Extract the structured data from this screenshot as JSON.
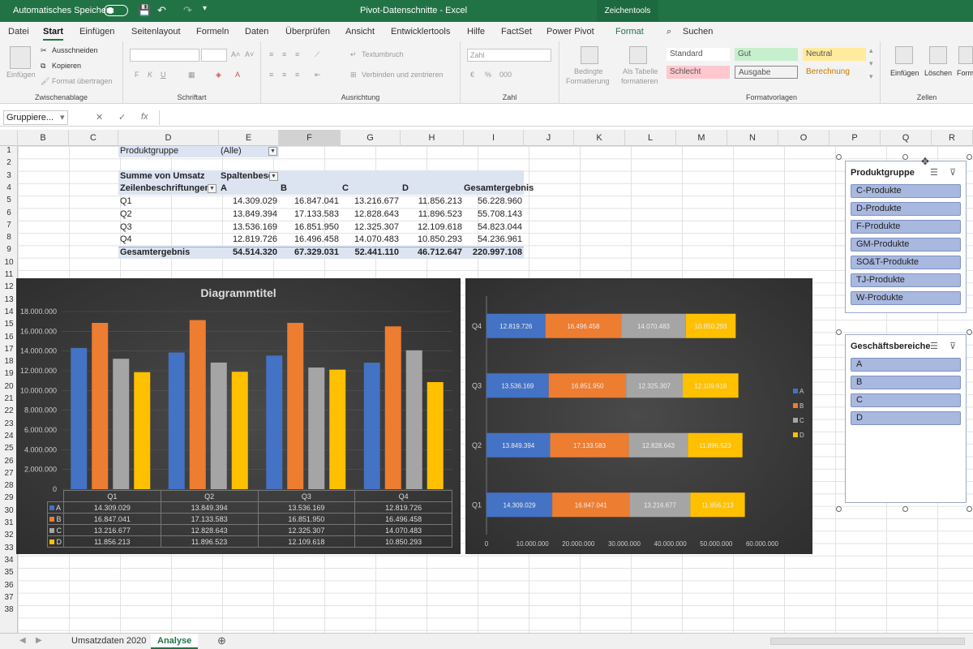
{
  "titlebar": {
    "autosave": "Automatisches Speichern",
    "title": "Pivot-Datenschnitte - Excel",
    "context_tab": "Zeichentools"
  },
  "menu": [
    "Datei",
    "Start",
    "Einfügen",
    "Seitenlayout",
    "Formeln",
    "Daten",
    "Überprüfen",
    "Ansicht",
    "Entwicklertools",
    "Hilfe",
    "FactSet",
    "Power Pivot",
    "Format"
  ],
  "search": "Suchen",
  "ribbon": {
    "clipboard": {
      "label": "Zwischenablage",
      "paste": "Einfügen",
      "cut": "Ausschneiden",
      "copy": "Kopieren",
      "format_painter": "Format übertragen"
    },
    "font": {
      "label": "Schriftart",
      "bold": "F",
      "italic": "K",
      "underline": "U"
    },
    "alignment": {
      "label": "Ausrichtung",
      "wrap": "Textumbruch",
      "merge": "Verbinden und zentrieren"
    },
    "number": {
      "label": "Zahl",
      "format": "Zahl"
    },
    "cond": {
      "line1": "Bedingte",
      "line2": "Formatierung"
    },
    "astable": {
      "line1": "Als Tabelle",
      "line2": "formatieren"
    },
    "styles": {
      "label": "Formatvorlagen",
      "s1": "Standard",
      "s2": "Gut",
      "s3": "Neutral",
      "s4": "Schlecht",
      "s5": "Ausgabe",
      "s6": "Berechnung"
    },
    "cells": {
      "label": "Zellen",
      "insert": "Einfügen",
      "delete": "Löschen",
      "format": "Form"
    }
  },
  "formula": {
    "namebox": "Gruppiere...",
    "x": "✕",
    "check": "✓",
    "fx": "fx"
  },
  "columns": [
    "B",
    "C",
    "D",
    "E",
    "F",
    "G",
    "H",
    "I",
    "J",
    "K",
    "L",
    "M",
    "N",
    "O",
    "P",
    "Q",
    "R"
  ],
  "rows": [
    "1",
    "2",
    "3",
    "4",
    "5",
    "6",
    "7",
    "8",
    "9",
    "10",
    "11",
    "12",
    "13",
    "14",
    "15",
    "16",
    "17",
    "18",
    "19",
    "20",
    "21",
    "22",
    "23",
    "24",
    "25",
    "26",
    "27",
    "28",
    "29",
    "30",
    "31",
    "32",
    "33",
    "34",
    "35",
    "36",
    "37",
    "38"
  ],
  "pivot": {
    "filter_label": "Produktgruppe",
    "filter_value": "(Alle)",
    "sum_label": "Summe von Umsatz",
    "col_label": "Spaltenbesc",
    "row_label": "Zeilenbeschriftungen",
    "headers": [
      "A",
      "B",
      "C",
      "D",
      "Gesamtergebnis"
    ],
    "rows": [
      {
        "label": "Q1",
        "values": [
          "14.309.029",
          "16.847.041",
          "13.216.677",
          "11.856.213",
          "56.228.960"
        ]
      },
      {
        "label": "Q2",
        "values": [
          "13.849.394",
          "17.133.583",
          "12.828.643",
          "11.896.523",
          "55.708.143"
        ]
      },
      {
        "label": "Q3",
        "values": [
          "13.536.169",
          "16.851.950",
          "12.325.307",
          "12.109.618",
          "54.823.044"
        ]
      },
      {
        "label": "Q4",
        "values": [
          "12.819.726",
          "16.496.458",
          "14.070.483",
          "10.850.293",
          "54.236.961"
        ]
      }
    ],
    "total": {
      "label": "Gesamtergebnis",
      "values": [
        "54.514.320",
        "67.329.031",
        "52.441.110",
        "46.712.647",
        "220.997.108"
      ]
    }
  },
  "colors": {
    "A": "#4472c4",
    "B": "#ed7d31",
    "C": "#a5a5a5",
    "D": "#ffc000",
    "excel": "#217346"
  },
  "chart_data": [
    {
      "type": "bar",
      "title": "Diagrammtitel",
      "categories": [
        "Q1",
        "Q2",
        "Q3",
        "Q4"
      ],
      "series": [
        {
          "name": "A",
          "values": [
            14309029,
            13849394,
            13536169,
            12819726
          ]
        },
        {
          "name": "B",
          "values": [
            16847041,
            17133583,
            16851950,
            16496458
          ]
        },
        {
          "name": "C",
          "values": [
            13216677,
            12828643,
            12325307,
            14070483
          ]
        },
        {
          "name": "D",
          "values": [
            11856213,
            11896523,
            12109618,
            10850293
          ]
        }
      ],
      "ylim": [
        0,
        18000000
      ],
      "yticks": [
        "0",
        "2.000.000",
        "4.000.000",
        "6.000.000",
        "8.000.000",
        "10.000.000",
        "12.000.000",
        "14.000.000",
        "16.000.000",
        "18.000.000"
      ],
      "table": [
        [
          "14.309.029",
          "13.849.394",
          "13.536.169",
          "12.819.726"
        ],
        [
          "16.847.041",
          "17.133.583",
          "16.851.950",
          "16.496.458"
        ],
        [
          "13.216.677",
          "12.828.643",
          "12.325.307",
          "14.070.483"
        ],
        [
          "11.856.213",
          "11.896.523",
          "12.109.618",
          "10.850.293"
        ]
      ]
    },
    {
      "type": "bar",
      "orientation": "horizontal-stacked",
      "categories": [
        "Q1",
        "Q2",
        "Q3",
        "Q4"
      ],
      "series": [
        {
          "name": "A",
          "values": [
            14309029,
            13849394,
            13536169,
            12819726
          ],
          "labels": [
            "14.309.029",
            "13.849.394",
            "13.536.169",
            "12.819.726"
          ]
        },
        {
          "name": "B",
          "values": [
            16847041,
            17133583,
            16851950,
            16496458
          ],
          "labels": [
            "16.847.041",
            "17.133.583",
            "16.851.950",
            "16.496.458"
          ]
        },
        {
          "name": "C",
          "values": [
            13216677,
            12828643,
            12325307,
            14070483
          ],
          "labels": [
            "13.216.677",
            "12.828.643",
            "12.325.307",
            "14.070.483"
          ]
        },
        {
          "name": "D",
          "values": [
            11856213,
            11896523,
            12109618,
            10850293
          ],
          "labels": [
            "11.856.213",
            "11.896.523",
            "12.109.618",
            "10.850.293"
          ]
        }
      ],
      "xlim": [
        0,
        60000000
      ],
      "xticks": [
        "0",
        "10.000.000",
        "20.000.000",
        "30.000.000",
        "40.000.000",
        "50.000.000",
        "60.000.000"
      ],
      "legend": "right"
    }
  ],
  "slicers": [
    {
      "title": "Produktgruppe",
      "items": [
        "C-Produkte",
        "D-Produkte",
        "F-Produkte",
        "GM-Produkte",
        "SO&T-Produkte",
        "TJ-Produkte",
        "W-Produkte"
      ]
    },
    {
      "title": "Geschäftsbereiche",
      "items": [
        "A",
        "B",
        "C",
        "D"
      ]
    }
  ],
  "sheets": [
    "Umsatzdaten 2020",
    "Analyse"
  ]
}
